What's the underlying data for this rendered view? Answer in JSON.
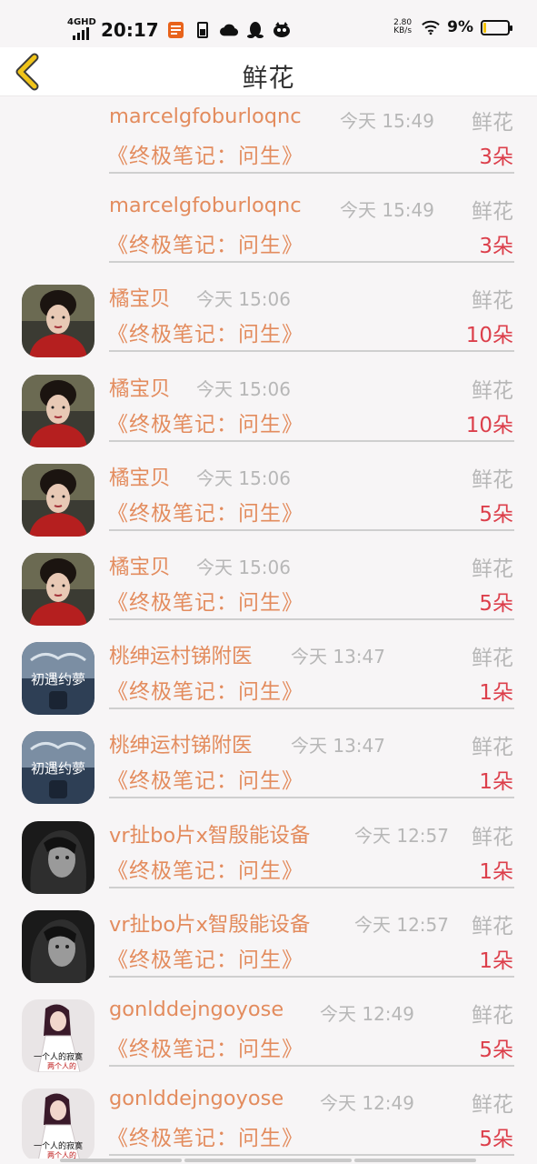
{
  "status_bar": {
    "network": "4GHD",
    "time": "20:17",
    "net_speed_value": "2.80",
    "net_speed_unit": "KB/s",
    "battery_percent": "9%",
    "battery_level": 0.09,
    "badge_color": "#e8631b",
    "battery_color": "#f2c200"
  },
  "nav": {
    "title": "鲜花",
    "back_icon": "chevron-left-icon",
    "back_icon_color": "#f0c419"
  },
  "colors": {
    "name": "#e38c5e",
    "count": "#dc3f4b",
    "meta": "#b7b7b7"
  },
  "rows": [
    {
      "user": "marcelgfoburloqnc",
      "time": "今天 15:49",
      "gift": "鲜花",
      "book": "《终极笔记：问生》",
      "count": "3朵",
      "avatar": "none"
    },
    {
      "user": "marcelgfoburloqnc",
      "time": "今天 15:49",
      "gift": "鲜花",
      "book": "《终极笔记：问生》",
      "count": "3朵",
      "avatar": "none"
    },
    {
      "user": "橘宝贝",
      "time": "今天 15:06",
      "gift": "鲜花",
      "book": "《终极笔记：问生》",
      "count": "10朵",
      "avatar": "woman-red-costume"
    },
    {
      "user": "橘宝贝",
      "time": "今天 15:06",
      "gift": "鲜花",
      "book": "《终极笔记：问生》",
      "count": "10朵",
      "avatar": "woman-red-costume"
    },
    {
      "user": "橘宝贝",
      "time": "今天 15:06",
      "gift": "鲜花",
      "book": "《终极笔记：问生》",
      "count": "5朵",
      "avatar": "woman-red-costume"
    },
    {
      "user": "橘宝贝",
      "time": "今天 15:06",
      "gift": "鲜花",
      "book": "《终极笔记：问生》",
      "count": "5朵",
      "avatar": "woman-red-costume"
    },
    {
      "user": "桃绅运村锑附医",
      "time": "今天 13:47",
      "gift": "鲜花",
      "book": "《终极笔记：问生》",
      "count": "1朵",
      "avatar": "blue-poster"
    },
    {
      "user": "桃绅运村锑附医",
      "time": "今天 13:47",
      "gift": "鲜花",
      "book": "《终极笔记：问生》",
      "count": "1朵",
      "avatar": "blue-poster"
    },
    {
      "user": "vr扯bo片x智殷能设备",
      "time": "今天 12:57",
      "gift": "鲜花",
      "book": "《终极笔记：问生》",
      "count": "1朵",
      "avatar": "bw-portrait"
    },
    {
      "user": "vr扯bo片x智殷能设备",
      "time": "今天 12:57",
      "gift": "鲜花",
      "book": "《终极笔记：问生》",
      "count": "1朵",
      "avatar": "bw-portrait"
    },
    {
      "user": "gonlddejngoyose",
      "time": "今天 12:49",
      "gift": "鲜花",
      "book": "《终极笔记：问生》",
      "count": "5朵",
      "avatar": "woman-white-dress"
    },
    {
      "user": "gonlddejngoyose",
      "time": "今天 12:49",
      "gift": "鲜花",
      "book": "《终极笔记：问生》",
      "count": "5朵",
      "avatar": "woman-white-dress"
    }
  ]
}
